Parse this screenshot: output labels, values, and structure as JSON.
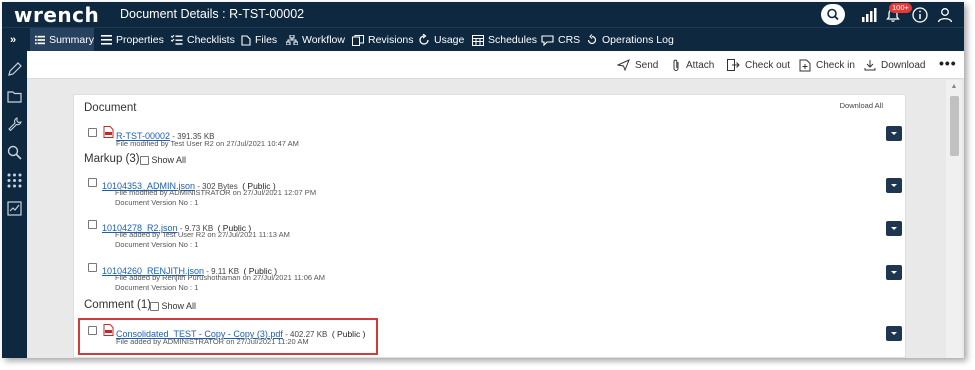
{
  "app": {
    "logo": "wrench",
    "title": "Document Details : R-TST-00002",
    "notification_badge": "100+"
  },
  "tabs": [
    {
      "label": "Summary",
      "icon": "list-icon",
      "active": true
    },
    {
      "label": "Properties",
      "icon": "properties-icon"
    },
    {
      "label": "Checklists",
      "icon": "checklist-icon"
    },
    {
      "label": "Files",
      "icon": "files-icon"
    },
    {
      "label": "Workflow",
      "icon": "workflow-icon"
    },
    {
      "label": "Revisions",
      "icon": "revisions-icon"
    },
    {
      "label": "Usage",
      "icon": "usage-icon"
    },
    {
      "label": "Schedules",
      "icon": "schedules-icon"
    },
    {
      "label": "CRS",
      "icon": "crs-icon"
    },
    {
      "label": "Operations Log",
      "icon": "operations-log-icon"
    }
  ],
  "expand_label": "»",
  "toolbar": {
    "send": "Send",
    "attach": "Attach",
    "checkout": "Check out",
    "checkin": "Check in",
    "download": "Download",
    "more": "•••"
  },
  "document_section": {
    "title": "Document",
    "download_all": "Download All",
    "file": {
      "name": "R-TST-00002",
      "size": " - 391.35 KB",
      "modified": "File modified by Test User R2 on 27/Jul/2021 10:47 AM"
    }
  },
  "markup_section": {
    "title": "Markup (3)",
    "show_all": "Show All",
    "files": [
      {
        "name": "10104353_ADMIN.json",
        "size": " - 302 Bytes",
        "access": "( Public )",
        "info": "File modified by ADMINISTRATOR on 27/Jul/2021 12:07 PM",
        "version": "Document Version No : 1"
      },
      {
        "name": "10104278_R2.json",
        "size": " - 9.73 KB",
        "access": "( Public )",
        "info": "File added by Test User R2 on 27/Jul/2021 11:13 AM",
        "version": "Document Version No : 1"
      },
      {
        "name": "10104260_RENJITH.json",
        "size": " - 9.11 KB",
        "access": "( Public )",
        "info": "File added by Renjith Purushothaman on 27/Jul/2021 11:06 AM",
        "version": "Document Version No : 1"
      }
    ]
  },
  "comment_section": {
    "title": "Comment (1)",
    "show_all": "Show All",
    "file": {
      "name": "Consolidated_TEST - Copy - Copy (3).pdf",
      "size": " - 402.27 KB",
      "access": "( Public )",
      "info": "File added by ADMINISTRATOR on 27/Jul/2021 11:20 AM"
    }
  },
  "colors": {
    "nav_bg": "#0e2840",
    "active_tab": "#27425e",
    "link": "#1a5fb4",
    "highlight": "#d23a3a",
    "pdf_red": "#c62828"
  }
}
